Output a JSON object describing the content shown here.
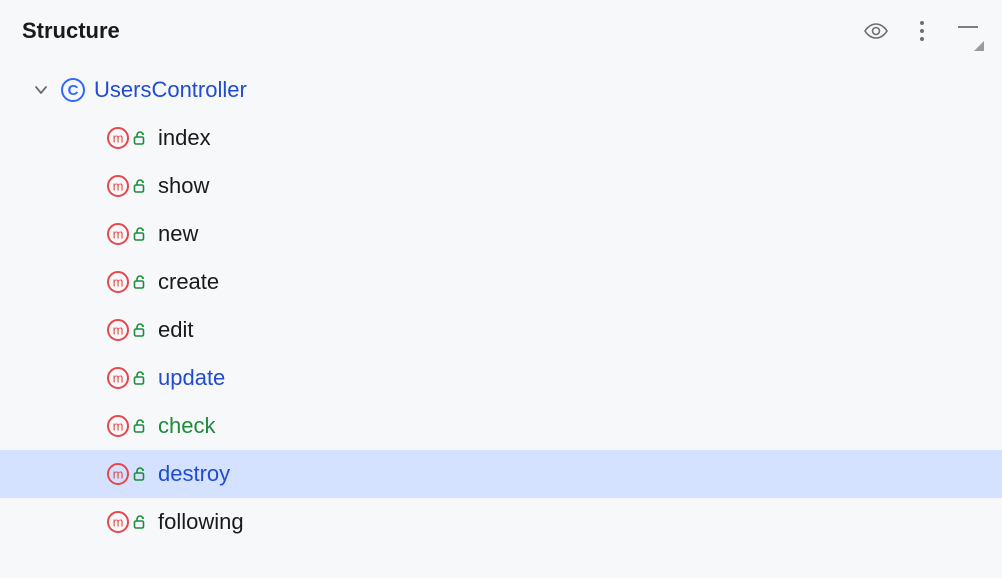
{
  "panel": {
    "title": "Structure"
  },
  "tree": {
    "class_name": "UsersController",
    "methods": [
      {
        "name": "index",
        "style": "default",
        "selected": false
      },
      {
        "name": "show",
        "style": "default",
        "selected": false
      },
      {
        "name": "new",
        "style": "default",
        "selected": false
      },
      {
        "name": "create",
        "style": "default",
        "selected": false
      },
      {
        "name": "edit",
        "style": "default",
        "selected": false
      },
      {
        "name": "update",
        "style": "blue",
        "selected": false
      },
      {
        "name": "check",
        "style": "green",
        "selected": false
      },
      {
        "name": "destroy",
        "style": "blue",
        "selected": true
      },
      {
        "name": "following",
        "style": "default",
        "selected": false
      }
    ]
  },
  "colors": {
    "selection_bg": "#d4e2ff",
    "class_icon_ring": "#3366ff",
    "method_icon_ring": "#e5484d",
    "lock_icon": "#1f8a3b"
  }
}
